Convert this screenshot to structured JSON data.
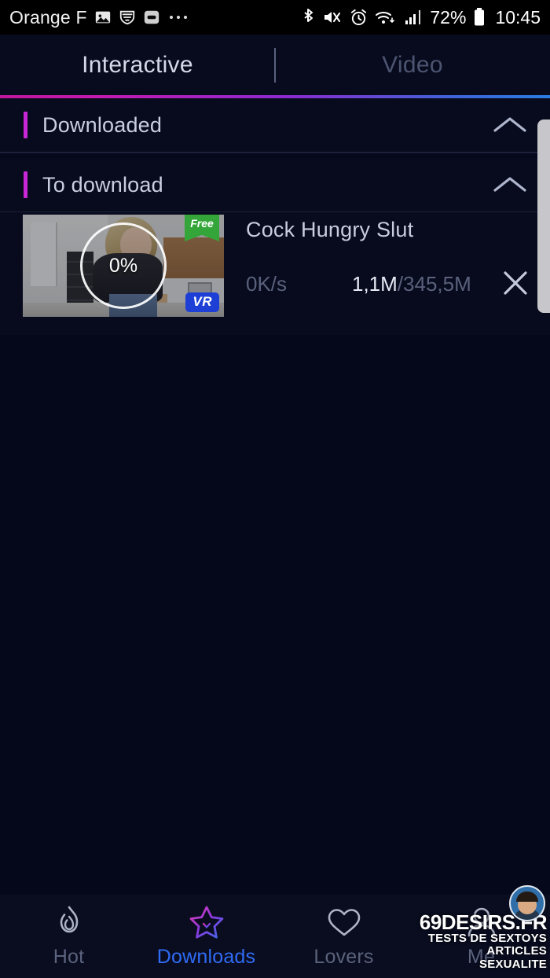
{
  "status_bar": {
    "carrier": "Orange F",
    "left_icons": [
      "image-icon",
      "wifi-shield-icon",
      "capsule-icon",
      "more-dots-icon"
    ],
    "right_icons": [
      "bluetooth-icon",
      "mute-icon",
      "alarm-icon",
      "wifi-icon",
      "signal-icon"
    ],
    "battery_percent": "72%",
    "battery_icon": "battery-icon",
    "clock": "10:45"
  },
  "tabs": {
    "items": [
      {
        "label": "Interactive",
        "active": true
      },
      {
        "label": "Video",
        "active": false
      }
    ],
    "underline_from": "#c0179c",
    "underline_to": "#2a7de0"
  },
  "sections": [
    {
      "title": "Downloaded",
      "accent": "#c927d6",
      "chevron": "chevron-up-icon",
      "expanded": true
    },
    {
      "title": "To download",
      "accent": "#c927d6",
      "chevron": "chevron-up-icon",
      "expanded": true
    }
  ],
  "download_item": {
    "title": "Cock Hungry Slut",
    "progress_label": "0%",
    "progress_percent": 0,
    "speed": "0K/s",
    "downloaded": "1,1M",
    "separator": "/",
    "total": "345,5M",
    "badge_free": "Free",
    "badge_free_color": "#34a639",
    "badge_vr": "VR",
    "badge_vr_color": "#1d3fd6",
    "cancel_icon": "close-icon"
  },
  "bottom_nav": {
    "items": [
      {
        "label": "Hot",
        "icon": "flame-icon",
        "active": false
      },
      {
        "label": "Downloads",
        "icon": "star-download-icon",
        "active": true
      },
      {
        "label": "Lovers",
        "icon": "heart-icon",
        "active": false
      },
      {
        "label": "Me",
        "icon": "person-icon",
        "active": false
      }
    ],
    "active_color": "#2f6bf5",
    "inactive_color": "#5a627c"
  },
  "watermark": {
    "site": "69DESIRS.FR",
    "line1": "TESTS DE SEXTOYS",
    "line2": "ARTICLES",
    "line3": "SEXUALITE",
    "avatar": "avatar-icon"
  }
}
